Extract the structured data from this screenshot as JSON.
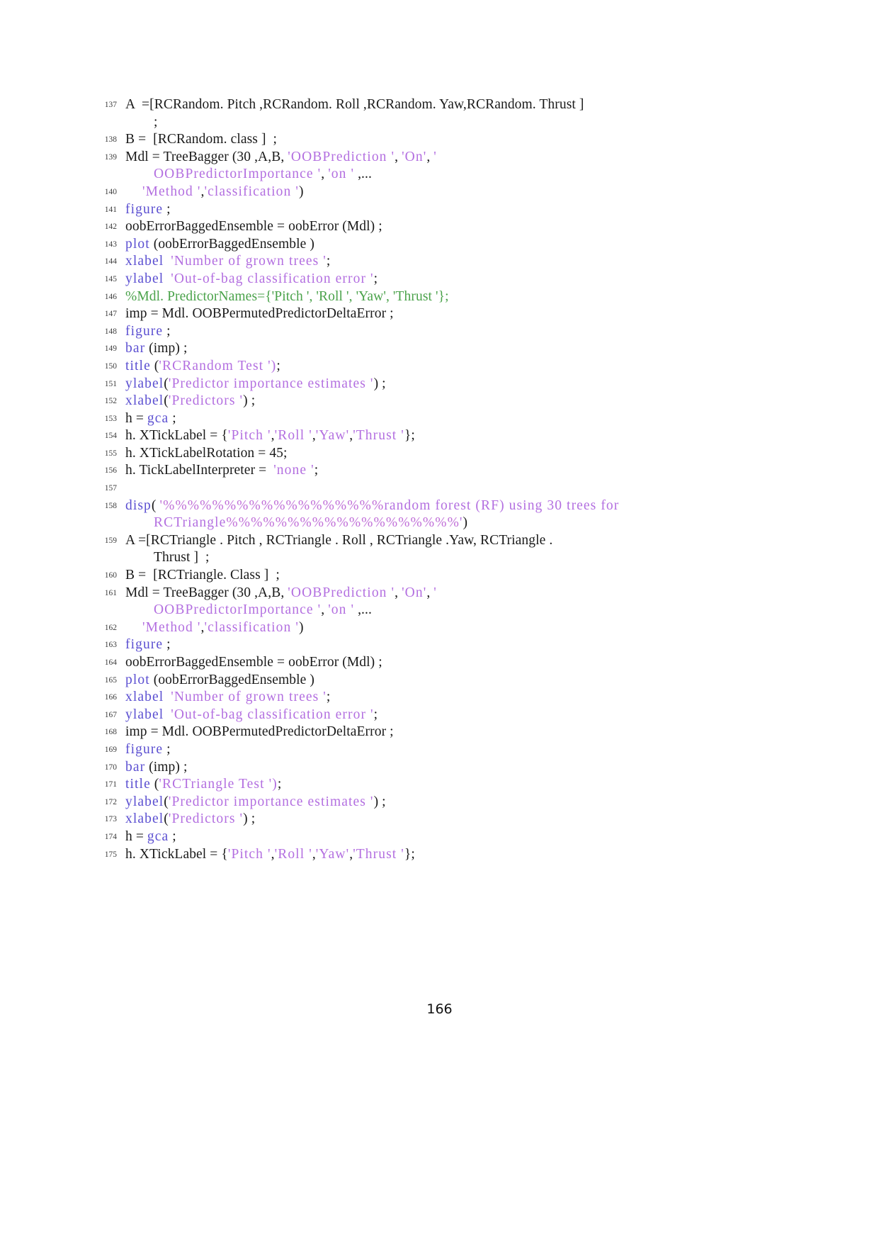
{
  "document": {
    "type": "latex-code-listing",
    "language": "MATLAB",
    "page_number": "166"
  },
  "colors": {
    "keyword": "#5b4fd1",
    "string": "#b36fe0",
    "comment": "#4aa24a",
    "percent_run": "#c06fd8",
    "plain": "#1a1a1a",
    "line_number": "#3d3d3d",
    "background": "#ffffff"
  },
  "listing": {
    "lines": [
      {
        "number": "137",
        "rows": [
          {
            "indent": "none",
            "parts": [
              {
                "t": "A  =[RCRandom. Pitch ,RCRandom. Roll ,RCRandom. Yaw,RCRandom. Thrust ]",
                "c": "id"
              }
            ]
          },
          {
            "indent": "cont",
            "parts": [
              {
                "t": ";",
                "c": "id"
              }
            ]
          }
        ]
      },
      {
        "number": "138",
        "rows": [
          {
            "indent": "none",
            "parts": [
              {
                "t": "B =  [RCRandom. class ]  ;",
                "c": "id"
              }
            ]
          }
        ]
      },
      {
        "number": "139",
        "rows": [
          {
            "indent": "none",
            "parts": [
              {
                "t": "Mdl = TreeBagger (30 ,A,B, ",
                "c": "id"
              },
              {
                "t": "'OOBPrediction '",
                "c": "str"
              },
              {
                "t": ", ",
                "c": "id"
              },
              {
                "t": "'On'",
                "c": "str"
              },
              {
                "t": ", ",
                "c": "id"
              },
              {
                "t": "'",
                "c": "str"
              }
            ]
          },
          {
            "indent": "cont",
            "parts": [
              {
                "t": "OOBPredictorImportance '",
                "c": "str"
              },
              {
                "t": ", ",
                "c": "id"
              },
              {
                "t": "'on '",
                "c": "str"
              },
              {
                "t": " ,...",
                "c": "id"
              }
            ]
          }
        ]
      },
      {
        "number": "140",
        "rows": [
          {
            "indent": "cont2",
            "parts": [
              {
                "t": "'Method '",
                "c": "str"
              },
              {
                "t": ",",
                "c": "id"
              },
              {
                "t": "'classification '",
                "c": "str"
              },
              {
                "t": ")",
                "c": "id"
              }
            ]
          }
        ]
      },
      {
        "number": "141",
        "rows": [
          {
            "indent": "none",
            "parts": [
              {
                "t": "figure",
                "c": "kw"
              },
              {
                "t": " ;",
                "c": "id"
              }
            ]
          }
        ]
      },
      {
        "number": "142",
        "rows": [
          {
            "indent": "none",
            "parts": [
              {
                "t": "oobErrorBaggedEnsemble = oobError (Mdl) ;",
                "c": "id"
              }
            ]
          }
        ]
      },
      {
        "number": "143",
        "rows": [
          {
            "indent": "none",
            "parts": [
              {
                "t": "plot",
                "c": "kw"
              },
              {
                "t": " (oobErrorBaggedEnsemble )",
                "c": "id"
              }
            ]
          }
        ]
      },
      {
        "number": "144",
        "rows": [
          {
            "indent": "none",
            "parts": [
              {
                "t": "xlabel",
                "c": "kw"
              },
              {
                "t": "  ",
                "c": "id"
              },
              {
                "t": "'Number of grown trees '",
                "c": "str"
              },
              {
                "t": ";",
                "c": "id"
              }
            ]
          }
        ]
      },
      {
        "number": "145",
        "rows": [
          {
            "indent": "none",
            "parts": [
              {
                "t": "ylabel",
                "c": "kw"
              },
              {
                "t": "  ",
                "c": "id"
              },
              {
                "t": "'Out-of-bag classification error '",
                "c": "str"
              },
              {
                "t": ";",
                "c": "id"
              }
            ]
          }
        ]
      },
      {
        "number": "146",
        "rows": [
          {
            "indent": "none",
            "parts": [
              {
                "t": "%Mdl. PredictorNames={'Pitch ', 'Roll ', 'Yaw', 'Thrust '};",
                "c": "cmt"
              }
            ]
          }
        ]
      },
      {
        "number": "147",
        "rows": [
          {
            "indent": "none",
            "parts": [
              {
                "t": "imp = Mdl. OOBPermutedPredictorDeltaError ;",
                "c": "id"
              }
            ]
          }
        ]
      },
      {
        "number": "148",
        "rows": [
          {
            "indent": "none",
            "parts": [
              {
                "t": "figure",
                "c": "kw"
              },
              {
                "t": " ;",
                "c": "id"
              }
            ]
          }
        ]
      },
      {
        "number": "149",
        "rows": [
          {
            "indent": "none",
            "parts": [
              {
                "t": "bar",
                "c": "kw"
              },
              {
                "t": " (imp) ;",
                "c": "id"
              }
            ]
          }
        ]
      },
      {
        "number": "150",
        "rows": [
          {
            "indent": "none",
            "parts": [
              {
                "t": "title",
                "c": "kw"
              },
              {
                "t": " (",
                "c": "id"
              },
              {
                "t": "'RCRandom Test ')",
                "c": "str"
              },
              {
                "t": ";",
                "c": "id"
              }
            ]
          }
        ]
      },
      {
        "number": "151",
        "rows": [
          {
            "indent": "none",
            "parts": [
              {
                "t": "ylabel",
                "c": "kw"
              },
              {
                "t": "(",
                "c": "id"
              },
              {
                "t": "'Predictor importance estimates '",
                "c": "str"
              },
              {
                "t": ") ;",
                "c": "id"
              }
            ]
          }
        ]
      },
      {
        "number": "152",
        "rows": [
          {
            "indent": "none",
            "parts": [
              {
                "t": "xlabel",
                "c": "kw"
              },
              {
                "t": "(",
                "c": "id"
              },
              {
                "t": "'Predictors '",
                "c": "str"
              },
              {
                "t": ") ;",
                "c": "id"
              }
            ]
          }
        ]
      },
      {
        "number": "153",
        "rows": [
          {
            "indent": "none",
            "parts": [
              {
                "t": "h = ",
                "c": "id"
              },
              {
                "t": "gca",
                "c": "kw"
              },
              {
                "t": " ;",
                "c": "id"
              }
            ]
          }
        ]
      },
      {
        "number": "154",
        "rows": [
          {
            "indent": "none",
            "parts": [
              {
                "t": "h. XTickLabel = {",
                "c": "id"
              },
              {
                "t": "'Pitch '",
                "c": "str"
              },
              {
                "t": ",",
                "c": "id"
              },
              {
                "t": "'Roll '",
                "c": "str"
              },
              {
                "t": ",",
                "c": "id"
              },
              {
                "t": "'Yaw'",
                "c": "str"
              },
              {
                "t": ",",
                "c": "id"
              },
              {
                "t": "'Thrust '",
                "c": "str"
              },
              {
                "t": "};",
                "c": "id"
              }
            ]
          }
        ]
      },
      {
        "number": "155",
        "rows": [
          {
            "indent": "none",
            "parts": [
              {
                "t": "h. XTickLabelRotation = 45;",
                "c": "id"
              }
            ]
          }
        ]
      },
      {
        "number": "156",
        "rows": [
          {
            "indent": "none",
            "parts": [
              {
                "t": "h. TickLabelInterpreter =  ",
                "c": "id"
              },
              {
                "t": "'none '",
                "c": "str"
              },
              {
                "t": ";",
                "c": "id"
              }
            ]
          }
        ]
      },
      {
        "number": "157",
        "rows": [
          {
            "indent": "none",
            "parts": [
              {
                "t": "",
                "c": "id"
              }
            ]
          }
        ]
      },
      {
        "number": "158",
        "rows": [
          {
            "indent": "none",
            "parts": [
              {
                "t": "disp",
                "c": "kw"
              },
              {
                "t": "( ",
                "c": "id"
              },
              {
                "t": "'%%%%%%%%%%%%%%%%%%",
                "c": "pct"
              },
              {
                "t": "random forest (RF) using 30 trees for",
                "c": "str"
              }
            ]
          },
          {
            "indent": "cont",
            "parts": [
              {
                "t": "RCTriangle",
                "c": "str"
              },
              {
                "t": "%%%%%%%%%%%%%%%%%%%",
                "c": "pct"
              },
              {
                "t": "'",
                "c": "str"
              },
              {
                "t": ")",
                "c": "id"
              }
            ]
          }
        ]
      },
      {
        "number": "159",
        "rows": [
          {
            "indent": "none",
            "parts": [
              {
                "t": "A =[RCTriangle . Pitch , RCTriangle . Roll , RCTriangle .Yaw, RCTriangle .",
                "c": "id"
              }
            ]
          },
          {
            "indent": "cont",
            "parts": [
              {
                "t": "Thrust ]  ;",
                "c": "id"
              }
            ]
          }
        ]
      },
      {
        "number": "160",
        "rows": [
          {
            "indent": "none",
            "parts": [
              {
                "t": "B =  [RCTriangle. Class ]  ;",
                "c": "id"
              }
            ]
          }
        ]
      },
      {
        "number": "161",
        "rows": [
          {
            "indent": "none",
            "parts": [
              {
                "t": "Mdl = TreeBagger (30 ,A,B, ",
                "c": "id"
              },
              {
                "t": "'OOBPrediction '",
                "c": "str"
              },
              {
                "t": ", ",
                "c": "id"
              },
              {
                "t": "'On'",
                "c": "str"
              },
              {
                "t": ", ",
                "c": "id"
              },
              {
                "t": "'",
                "c": "str"
              }
            ]
          },
          {
            "indent": "cont",
            "parts": [
              {
                "t": "OOBPredictorImportance '",
                "c": "str"
              },
              {
                "t": ", ",
                "c": "id"
              },
              {
                "t": "'on '",
                "c": "str"
              },
              {
                "t": " ,...",
                "c": "id"
              }
            ]
          }
        ]
      },
      {
        "number": "162",
        "rows": [
          {
            "indent": "cont2",
            "parts": [
              {
                "t": "'Method '",
                "c": "str"
              },
              {
                "t": ",",
                "c": "id"
              },
              {
                "t": "'classification '",
                "c": "str"
              },
              {
                "t": ")",
                "c": "id"
              }
            ]
          }
        ]
      },
      {
        "number": "163",
        "rows": [
          {
            "indent": "none",
            "parts": [
              {
                "t": "figure",
                "c": "kw"
              },
              {
                "t": " ;",
                "c": "id"
              }
            ]
          }
        ]
      },
      {
        "number": "164",
        "rows": [
          {
            "indent": "none",
            "parts": [
              {
                "t": "oobErrorBaggedEnsemble = oobError (Mdl) ;",
                "c": "id"
              }
            ]
          }
        ]
      },
      {
        "number": "165",
        "rows": [
          {
            "indent": "none",
            "parts": [
              {
                "t": "plot",
                "c": "kw"
              },
              {
                "t": " (oobErrorBaggedEnsemble )",
                "c": "id"
              }
            ]
          }
        ]
      },
      {
        "number": "166",
        "rows": [
          {
            "indent": "none",
            "parts": [
              {
                "t": "xlabel",
                "c": "kw"
              },
              {
                "t": "  ",
                "c": "id"
              },
              {
                "t": "'Number of grown trees '",
                "c": "str"
              },
              {
                "t": ";",
                "c": "id"
              }
            ]
          }
        ]
      },
      {
        "number": "167",
        "rows": [
          {
            "indent": "none",
            "parts": [
              {
                "t": "ylabel",
                "c": "kw"
              },
              {
                "t": "  ",
                "c": "id"
              },
              {
                "t": "'Out-of-bag classification error '",
                "c": "str"
              },
              {
                "t": ";",
                "c": "id"
              }
            ]
          }
        ]
      },
      {
        "number": "168",
        "rows": [
          {
            "indent": "none",
            "parts": [
              {
                "t": "imp = Mdl. OOBPermutedPredictorDeltaError ;",
                "c": "id"
              }
            ]
          }
        ]
      },
      {
        "number": "169",
        "rows": [
          {
            "indent": "none",
            "parts": [
              {
                "t": "figure",
                "c": "kw"
              },
              {
                "t": " ;",
                "c": "id"
              }
            ]
          }
        ]
      },
      {
        "number": "170",
        "rows": [
          {
            "indent": "none",
            "parts": [
              {
                "t": "bar",
                "c": "kw"
              },
              {
                "t": " (imp) ;",
                "c": "id"
              }
            ]
          }
        ]
      },
      {
        "number": "171",
        "rows": [
          {
            "indent": "none",
            "parts": [
              {
                "t": "title",
                "c": "kw"
              },
              {
                "t": " (",
                "c": "id"
              },
              {
                "t": "'RCTriangle Test ')",
                "c": "str"
              },
              {
                "t": ";",
                "c": "id"
              }
            ]
          }
        ]
      },
      {
        "number": "172",
        "rows": [
          {
            "indent": "none",
            "parts": [
              {
                "t": "ylabel",
                "c": "kw"
              },
              {
                "t": "(",
                "c": "id"
              },
              {
                "t": "'Predictor importance estimates '",
                "c": "str"
              },
              {
                "t": ") ;",
                "c": "id"
              }
            ]
          }
        ]
      },
      {
        "number": "173",
        "rows": [
          {
            "indent": "none",
            "parts": [
              {
                "t": "xlabel",
                "c": "kw"
              },
              {
                "t": "(",
                "c": "id"
              },
              {
                "t": "'Predictors '",
                "c": "str"
              },
              {
                "t": ") ;",
                "c": "id"
              }
            ]
          }
        ]
      },
      {
        "number": "174",
        "rows": [
          {
            "indent": "none",
            "parts": [
              {
                "t": "h = ",
                "c": "id"
              },
              {
                "t": "gca",
                "c": "kw"
              },
              {
                "t": " ;",
                "c": "id"
              }
            ]
          }
        ]
      },
      {
        "number": "175",
        "rows": [
          {
            "indent": "none",
            "parts": [
              {
                "t": "h. XTickLabel = {",
                "c": "id"
              },
              {
                "t": "'Pitch '",
                "c": "str"
              },
              {
                "t": ",",
                "c": "id"
              },
              {
                "t": "'Roll '",
                "c": "str"
              },
              {
                "t": ",",
                "c": "id"
              },
              {
                "t": "'Yaw'",
                "c": "str"
              },
              {
                "t": ",",
                "c": "id"
              },
              {
                "t": "'Thrust '",
                "c": "str"
              },
              {
                "t": "};",
                "c": "id"
              }
            ]
          }
        ]
      }
    ]
  }
}
